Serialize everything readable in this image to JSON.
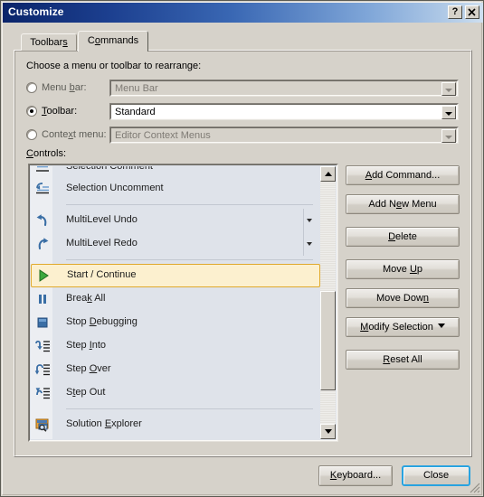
{
  "window": {
    "title": "Customize",
    "help_button": "?",
    "close_button": "✕",
    "accent_focus": "#29a3e0",
    "titlebar_gradient_start": "#0a246a",
    "titlebar_gradient_end": "#cfe0f0",
    "dialog_bg": "#d6d2ca"
  },
  "tabs": [
    {
      "label": "Toolbars",
      "accel": "s",
      "selected": false
    },
    {
      "label": "Commands",
      "accel": "o",
      "selected": true
    }
  ],
  "panel": {
    "choose_label": "Choose a menu or toolbar to rearrange:",
    "controls_label": "Controls:",
    "controls_accel": "C"
  },
  "radios": [
    {
      "label": "Menu bar:",
      "accel": "b",
      "checked": false,
      "enabled": false,
      "combo_value": "Menu Bar",
      "combo_enabled": false
    },
    {
      "label": "Toolbar:",
      "accel": "T",
      "checked": true,
      "enabled": true,
      "combo_value": "Standard",
      "combo_enabled": true
    },
    {
      "label": "Context menu:",
      "accel": "x",
      "checked": false,
      "enabled": false,
      "combo_value": "Editor Context Menus",
      "combo_enabled": false
    }
  ],
  "controls_list": {
    "background": "#dfe3ea",
    "selected_bg": "#fcf0cf",
    "selected_border": "#e0a92c",
    "items": [
      {
        "label": "Selection Comment",
        "icon": "comment-lines-icon",
        "clipped": true,
        "selected": false,
        "dropdown": false
      },
      {
        "label": "Selection Uncomment",
        "icon": "uncomment-lines-icon",
        "clipped": false,
        "selected": false,
        "dropdown": false
      },
      {
        "separator": true
      },
      {
        "label": "MultiLevel Undo",
        "icon": "undo-arrow-icon",
        "clipped": false,
        "selected": false,
        "dropdown": true
      },
      {
        "label": "MultiLevel Redo",
        "icon": "redo-arrow-icon",
        "clipped": false,
        "selected": false,
        "dropdown": true
      },
      {
        "separator": true
      },
      {
        "label": "Start / Continue",
        "icon": "play-green-icon",
        "clipped": false,
        "selected": true,
        "dropdown": false
      },
      {
        "label": "Break All",
        "icon": "pause-bars-icon",
        "clipped": false,
        "selected": false,
        "dropdown": false,
        "accel": "k"
      },
      {
        "label": "Stop Debugging",
        "icon": "stop-square-icon",
        "clipped": false,
        "selected": false,
        "dropdown": false,
        "accel": "D"
      },
      {
        "label": "Step Into",
        "icon": "step-into-icon",
        "clipped": false,
        "selected": false,
        "dropdown": false,
        "accel": "I"
      },
      {
        "label": "Step Over",
        "icon": "step-over-icon",
        "clipped": false,
        "selected": false,
        "dropdown": false,
        "accel": "O"
      },
      {
        "label": "Step Out",
        "icon": "step-out-icon",
        "clipped": false,
        "selected": false,
        "dropdown": false,
        "accel": "t"
      },
      {
        "separator": true
      },
      {
        "label": "Solution Explorer",
        "icon": "solution-explorer-icon",
        "clipped": false,
        "selected": false,
        "dropdown": false,
        "accel": "E"
      }
    ],
    "scrollbar": {
      "up_arrow": "▲",
      "down_arrow": "▼",
      "thumb_top_pct": 45,
      "thumb_height_pct": 41
    }
  },
  "side_buttons": [
    {
      "label": "Add Command...",
      "accel": "A",
      "caret": false
    },
    {
      "label": "Add New Menu",
      "accel": "e",
      "caret": false
    },
    {
      "label": "Delete",
      "accel": "D",
      "caret": false
    },
    {
      "label": "Move Up",
      "accel": "U",
      "caret": false
    },
    {
      "label": "Move Down",
      "accel": "n",
      "caret": false
    },
    {
      "label": "Modify Selection",
      "accel": "M",
      "caret": true
    },
    {
      "label": "Reset All",
      "accel": "R",
      "caret": false
    }
  ],
  "footer_buttons": [
    {
      "label": "Keyboard...",
      "accel": "K",
      "default": false
    },
    {
      "label": "Close",
      "accel": "",
      "default": true
    }
  ]
}
